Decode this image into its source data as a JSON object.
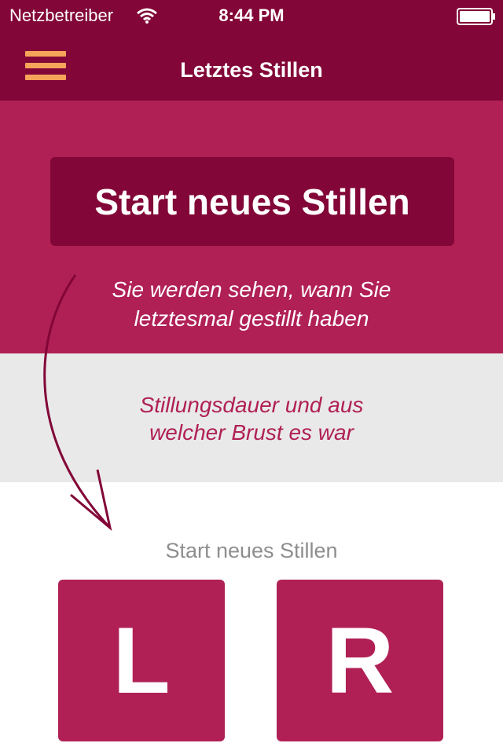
{
  "status_bar": {
    "carrier": "Netzbetreiber",
    "time": "8:44 PM",
    "wifi_icon": "wifi-icon",
    "battery_icon": "battery-icon"
  },
  "nav": {
    "title": "Letztes Stillen",
    "menu_icon": "hamburger-menu-icon",
    "menu_color": "#f5a45a"
  },
  "hero": {
    "button_label": "Start neues Stillen",
    "hint_line1": "Sie werden sehen, wann Sie",
    "hint_line2": "letztesmal gestillt haben"
  },
  "info": {
    "line1": "Stillungsdauer und aus",
    "line2": "welcher Brust es war"
  },
  "start": {
    "subtitle": "Start neues Stillen",
    "left_label": "L",
    "right_label": "R"
  },
  "colors": {
    "dark_brand": "#820637",
    "brand": "#b02055",
    "grey_band": "#e9e9e9"
  }
}
